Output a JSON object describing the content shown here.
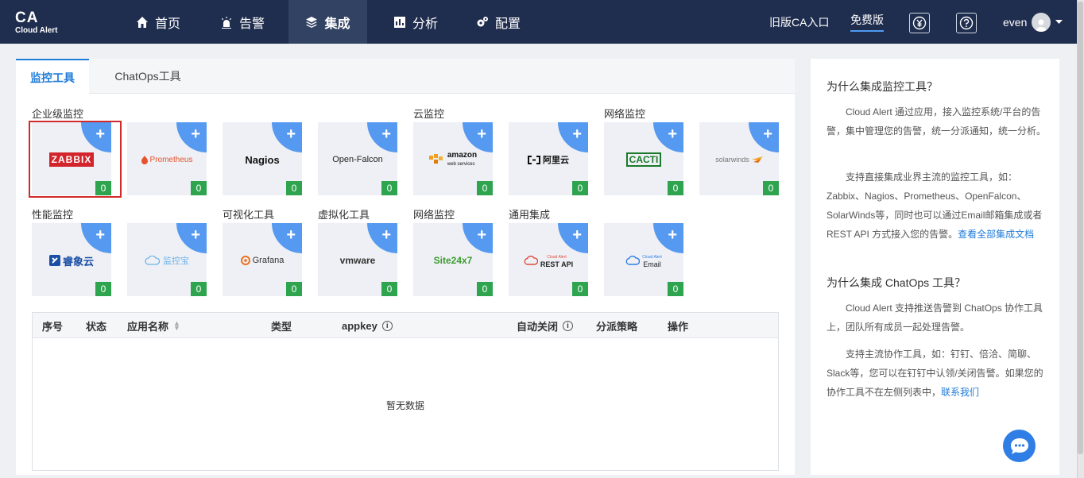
{
  "logo": {
    "title": "CA",
    "subtitle": "Cloud Alert"
  },
  "nav": {
    "items": [
      {
        "label": "首页"
      },
      {
        "label": "告警"
      },
      {
        "label": "集成"
      },
      {
        "label": "分析"
      },
      {
        "label": "配置"
      }
    ],
    "active_index": 2,
    "legacy_link": "旧版CA入口",
    "free_link": "免费版",
    "username": "even"
  },
  "tabs": [
    {
      "label": "监控工具"
    },
    {
      "label": "ChatOps工具"
    }
  ],
  "sections": {
    "enterprise": "企业级监控",
    "cloud": "云监控",
    "network1": "网络监控",
    "performance": "性能监控",
    "visualization": "可视化工具",
    "virtualization": "虚拟化工具",
    "network2": "网络监控",
    "generic": "通用集成"
  },
  "tiles": [
    {
      "name": "ZABBIX",
      "count": "0"
    },
    {
      "name": "Prometheus",
      "count": "0"
    },
    {
      "name": "Nagios",
      "count": "0"
    },
    {
      "name": "Open-Falcon",
      "count": "0"
    },
    {
      "name_top": "amazon",
      "name_bottom": "web services",
      "count": "0"
    },
    {
      "name": "阿里云",
      "count": "0"
    },
    {
      "name": "CACTI",
      "count": "0"
    },
    {
      "name": "solarwinds",
      "count": "0"
    },
    {
      "name": "睿象云",
      "count": "0"
    },
    {
      "name": "监控宝",
      "count": "0"
    },
    {
      "name": "Grafana",
      "count": "0"
    },
    {
      "name": "vmware",
      "count": "0"
    },
    {
      "name": "Site24x7",
      "count": "0"
    },
    {
      "name_top": "Cloud Alert",
      "name_bottom": "REST API",
      "count": "0"
    },
    {
      "name_top": "Cloud Alert",
      "name_bottom": "Email",
      "count": "0"
    }
  ],
  "plus_symbol": "+",
  "table": {
    "headers": {
      "index": "序号",
      "status": "状态",
      "app_name": "应用名称",
      "type": "类型",
      "appkey": "appkey",
      "auto_close": "自动关闭",
      "dispatch": "分派策略",
      "actions": "操作"
    },
    "empty_text": "暂无数据"
  },
  "side": {
    "h1": "为什么集成监控工具？",
    "p1": "Cloud Alert 通过应用，接入监控系统/平台的告警，集中管理您的告警，统一分派通知，统一分析。",
    "p2": "支持直接集成业界主流的监控工具，如：Zabbix、Nagios、Prometheus、OpenFalcon、SolarWinds等，同时也可以通过Email邮箱集成或者 REST API 方式接入您的告警。",
    "p2_link": "查看全部集成文档",
    "h2": "为什么集成 ChatOps 工具？",
    "p3": "Cloud Alert 支持推送告警到 ChatOps 协作工具上，团队所有成员一起处理告警。",
    "p4": "支持主流协作工具，如：钉钉、倍洽、简聊、Slack等，您可以在钉钉中认领/关闭告警。如果您的协作工具不在左侧列表中，",
    "p4_link": "联系我们"
  },
  "colors": {
    "nav_bg": "#1f2d4e",
    "accent": "#1f7bd8",
    "tile_corner": "#5599f0",
    "count_badge": "#2ea44f",
    "selected_border": "#d22a2a"
  }
}
